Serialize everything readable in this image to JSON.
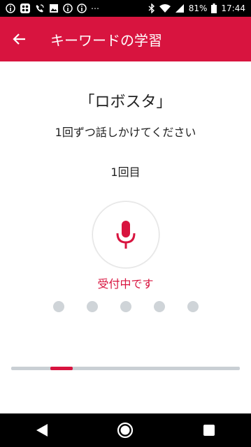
{
  "status_bar": {
    "battery": "81%",
    "time": "17:44",
    "icons": [
      "info-icon",
      "grid-icon",
      "wifi-calling-icon",
      "image-icon",
      "info-icon",
      "info-icon",
      "more-icon",
      "bluetooth-icon",
      "wifi-icon",
      "signal-icon",
      "battery-icon"
    ],
    "more": "⋯"
  },
  "app_bar": {
    "title": "キーワードの学習",
    "back_icon": "arrow-back-icon"
  },
  "main": {
    "keyword": "「ロボスタ」",
    "instruction": "1回ずつ話しかけてください",
    "count": "1回目",
    "mic_icon": "microphone-icon",
    "status": "受付中です",
    "dots_count": 5
  },
  "progress": {
    "start_fraction": 0.17,
    "fill_fraction": 0.1
  },
  "colors": {
    "accent": "#d8143f",
    "dot": "#cfd4d8",
    "track": "#c9cfd4"
  },
  "nav_bar": {
    "back": "nav-back-icon",
    "home": "nav-home-icon",
    "recents": "nav-recents-icon"
  }
}
